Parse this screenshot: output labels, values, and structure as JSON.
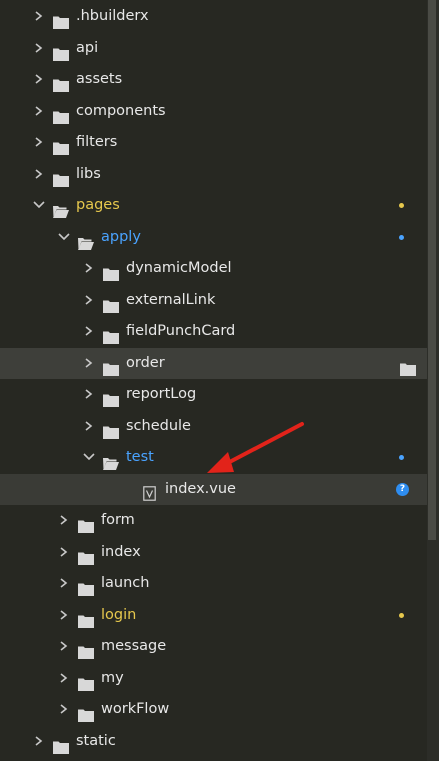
{
  "explorer": {
    "accent_colors": {
      "blue": "#4aa3ff",
      "gold": "#e6c84d",
      "badge": "#2e8df0"
    },
    "items": [
      {
        "label": ".hbuilderx",
        "depth": 0,
        "type": "folder",
        "expanded": false,
        "color": "default",
        "marker": "none",
        "icon": "folder-icon"
      },
      {
        "label": "api",
        "depth": 0,
        "type": "folder",
        "expanded": false,
        "color": "default",
        "marker": "none",
        "icon": "folder-icon"
      },
      {
        "label": "assets",
        "depth": 0,
        "type": "folder",
        "expanded": false,
        "color": "default",
        "marker": "none",
        "icon": "folder-icon"
      },
      {
        "label": "components",
        "depth": 0,
        "type": "folder",
        "expanded": false,
        "color": "default",
        "marker": "none",
        "icon": "folder-icon"
      },
      {
        "label": "filters",
        "depth": 0,
        "type": "folder",
        "expanded": false,
        "color": "default",
        "marker": "none",
        "icon": "folder-icon"
      },
      {
        "label": "libs",
        "depth": 0,
        "type": "folder",
        "expanded": false,
        "color": "default",
        "marker": "none",
        "icon": "folder-icon"
      },
      {
        "label": "pages",
        "depth": 0,
        "type": "folder",
        "expanded": true,
        "color": "gold",
        "marker": "gold-dot",
        "icon": "folder-open-icon"
      },
      {
        "label": "apply",
        "depth": 1,
        "type": "folder",
        "expanded": true,
        "color": "blue",
        "marker": "blue-dot",
        "icon": "folder-open-icon"
      },
      {
        "label": "dynamicModel",
        "depth": 2,
        "type": "folder",
        "expanded": false,
        "color": "default",
        "marker": "none",
        "icon": "folder-icon"
      },
      {
        "label": "externalLink",
        "depth": 2,
        "type": "folder",
        "expanded": false,
        "color": "default",
        "marker": "none",
        "icon": "folder-icon"
      },
      {
        "label": "fieldPunchCard",
        "depth": 2,
        "type": "folder",
        "expanded": false,
        "color": "default",
        "marker": "none",
        "icon": "folder-icon"
      },
      {
        "label": "order",
        "depth": 2,
        "type": "folder",
        "expanded": false,
        "color": "default",
        "marker": "hover-folder-action",
        "state": "hover",
        "icon": "folder-icon"
      },
      {
        "label": "reportLog",
        "depth": 2,
        "type": "folder",
        "expanded": false,
        "color": "default",
        "marker": "none",
        "icon": "folder-icon"
      },
      {
        "label": "schedule",
        "depth": 2,
        "type": "folder",
        "expanded": false,
        "color": "default",
        "marker": "none",
        "icon": "folder-icon"
      },
      {
        "label": "test",
        "depth": 2,
        "type": "folder",
        "expanded": true,
        "color": "blue",
        "marker": "blue-dot",
        "icon": "folder-open-icon"
      },
      {
        "label": "index.vue",
        "depth": 3,
        "type": "file",
        "color": "default",
        "marker": "badge",
        "badge_text": "?",
        "state": "selected",
        "icon": "vue-file-icon"
      },
      {
        "label": "form",
        "depth": 1,
        "type": "folder",
        "expanded": false,
        "color": "default",
        "marker": "none",
        "icon": "folder-icon"
      },
      {
        "label": "index",
        "depth": 1,
        "type": "folder",
        "expanded": false,
        "color": "default",
        "marker": "none",
        "icon": "folder-icon"
      },
      {
        "label": "launch",
        "depth": 1,
        "type": "folder",
        "expanded": false,
        "color": "default",
        "marker": "none",
        "icon": "folder-icon"
      },
      {
        "label": "login",
        "depth": 1,
        "type": "folder",
        "expanded": false,
        "color": "gold",
        "marker": "gold-dot",
        "icon": "folder-icon"
      },
      {
        "label": "message",
        "depth": 1,
        "type": "folder",
        "expanded": false,
        "color": "default",
        "marker": "none",
        "icon": "folder-icon"
      },
      {
        "label": "my",
        "depth": 1,
        "type": "folder",
        "expanded": false,
        "color": "default",
        "marker": "none",
        "icon": "folder-icon"
      },
      {
        "label": "workFlow",
        "depth": 1,
        "type": "folder",
        "expanded": false,
        "color": "default",
        "marker": "none",
        "icon": "folder-icon"
      },
      {
        "label": "static",
        "depth": 0,
        "type": "folder",
        "expanded": false,
        "color": "default",
        "marker": "none",
        "icon": "folder-icon"
      }
    ]
  },
  "annotation": {
    "icon": "red-arrow-icon",
    "color": "#e2231a"
  }
}
